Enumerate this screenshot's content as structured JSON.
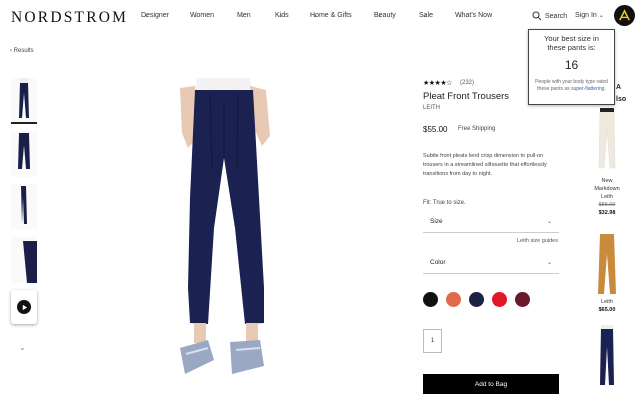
{
  "header": {
    "logo": "NORDSTROM",
    "nav": [
      "Designer",
      "Women",
      "Men",
      "Kids",
      "Home & Gifts",
      "Beauty",
      "Sale",
      "What's Now"
    ],
    "search_label": "Search",
    "signin_label": "Sign In"
  },
  "popup": {
    "title": "Your best size in these pants is:",
    "size": "16",
    "note_prefix": "People with your body type rated these pants as ",
    "note_link": "super-flattering",
    "note_suffix": "."
  },
  "results_link": "Results",
  "product": {
    "stars": "★★★★☆",
    "reviews": "(232)",
    "title": "Pleat Front Trousers",
    "brand": "LEITH",
    "price": "$55.00",
    "shipping": "Free Shipping",
    "description": "Subtle front pleats lend crisp dimension to pull-on trousers in a streamlined silhouette that effortlessly transitions from day to night.",
    "fit": "Fit: True to size.",
    "size_label": "Size",
    "size_guide": "Leith size guides",
    "color_label": "Color",
    "swatches": [
      "#111111",
      "#e06a4a",
      "#1c2340",
      "#e0182a",
      "#6a1a2a"
    ],
    "qty": "1",
    "add_to_bag": "Add to Bag"
  },
  "recommendations": {
    "header_line1": "A",
    "header_line2": "lso",
    "items": [
      {
        "badge": "New",
        "label": "Markdown",
        "brand": "Leith",
        "was": "$55.00",
        "price": "$32.98"
      },
      {
        "brand": "Leith",
        "price": "$65.00"
      }
    ]
  }
}
